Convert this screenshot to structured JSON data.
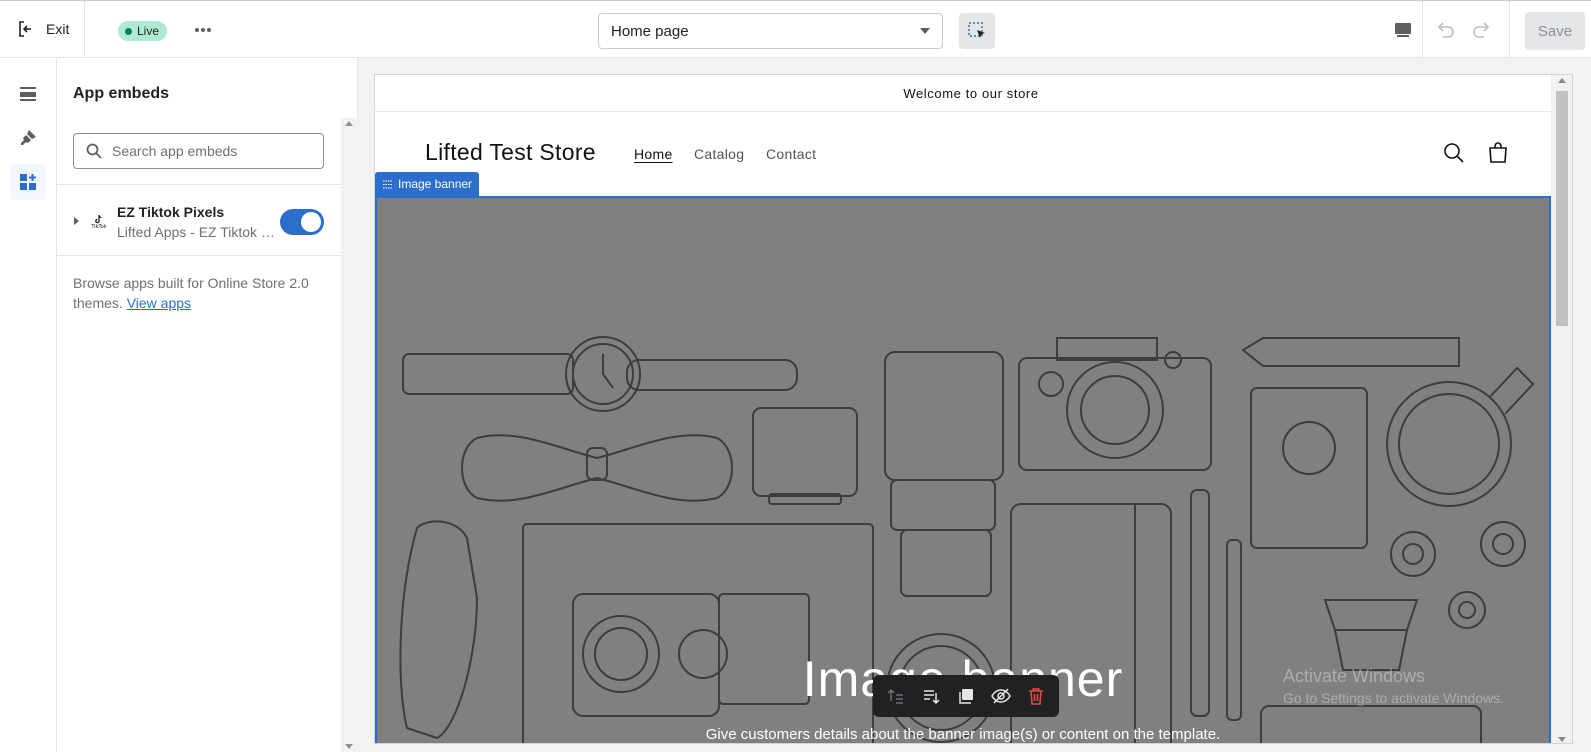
{
  "topbar": {
    "exit_label": "Exit",
    "status_badge": "Live",
    "page_selector": "Home page",
    "save_label": "Save"
  },
  "rail": {
    "items": [
      "sections-icon",
      "theme-settings-icon",
      "app-embeds-icon"
    ],
    "active": "app-embeds-icon"
  },
  "sidebar": {
    "title": "App embeds",
    "search_placeholder": "Search app embeds",
    "embeds": [
      {
        "name": "EZ Tiktok Pixels",
        "subtitle": "Lifted Apps - EZ Tiktok Pixels",
        "icon_label": "TikTok",
        "enabled": true
      }
    ],
    "browse_text": "Browse apps built for Online Store 2.0 themes.",
    "browse_link": "View apps"
  },
  "preview": {
    "announcement": "Welcome to our store",
    "store_name": "Lifted Test Store",
    "nav": [
      "Home",
      "Catalog",
      "Contact"
    ],
    "nav_active": "Home",
    "section_tag": "Image banner",
    "banner_heading": "Image banner",
    "banner_subtext": "Give customers details about the banner image(s) or content on the template.",
    "watermark_title": "Activate Windows",
    "watermark_sub": "Go to Settings to activate Windows.",
    "toolbar_icons": [
      "move-up-icon",
      "move-down-icon",
      "duplicate-icon",
      "hide-icon",
      "delete-icon"
    ]
  },
  "colors": {
    "accent": "#2c6ecb",
    "live_badge": "#aee9d1",
    "banner_overlay": "#808080",
    "delete": "#e04a4a"
  }
}
